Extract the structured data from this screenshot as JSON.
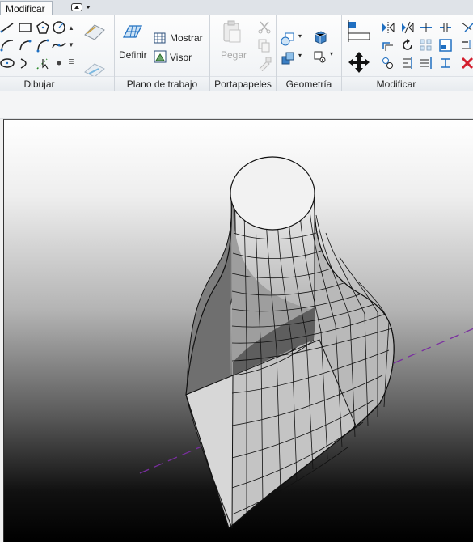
{
  "tabs": {
    "active": "Modificar"
  },
  "panels": {
    "dibujar": "Dibujar",
    "plano": "Plano de trabajo",
    "portapapeles": "Portapapeles",
    "geometria": "Geometría",
    "modificar": "Modificar"
  },
  "buttons": {
    "definir": "Definir",
    "mostrar": "Mostrar",
    "visor": "Visor",
    "pegar": "Pegar"
  },
  "colors": {
    "accent_blue": "#1f6fc1",
    "delete_red": "#d3202f",
    "workplane_line": "#7a2ea0"
  }
}
